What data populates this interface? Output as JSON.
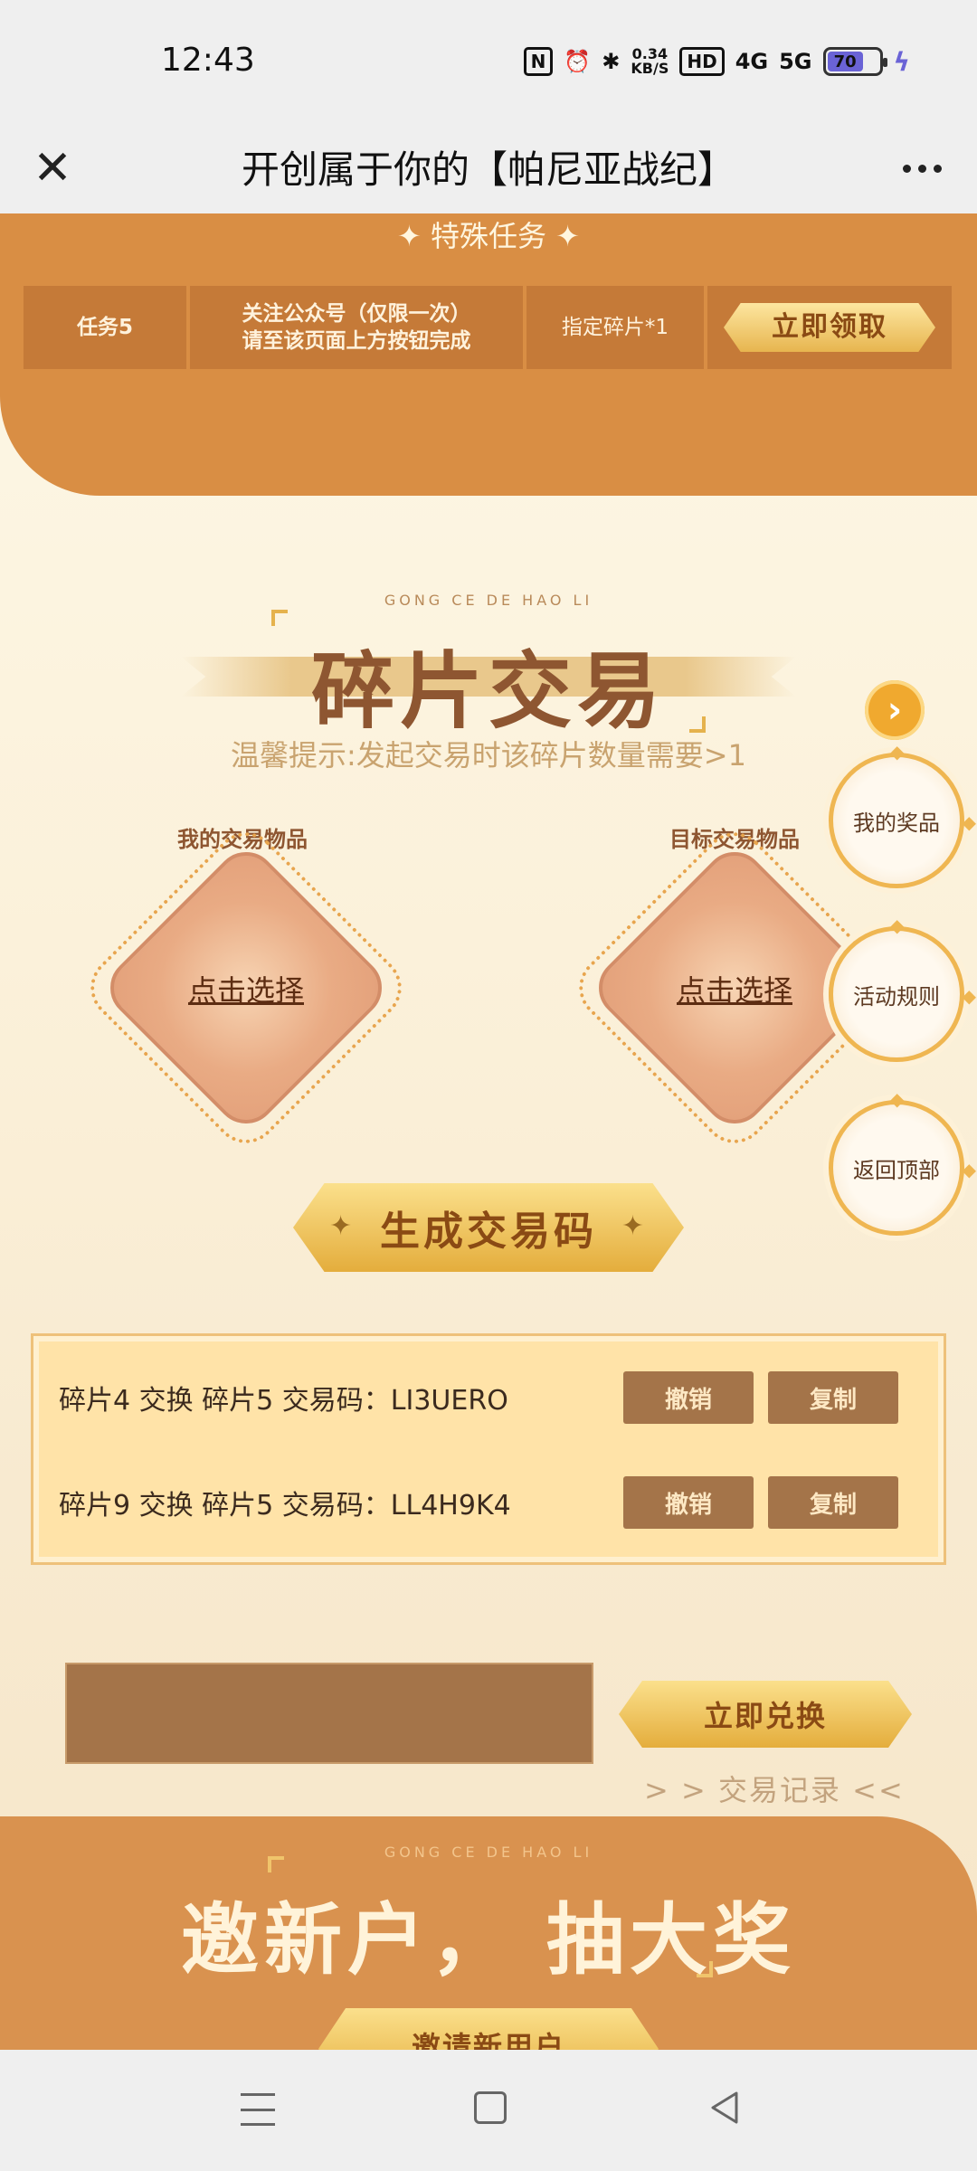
{
  "status_bar": {
    "time": "12:43",
    "nfc": "N",
    "alarm": "⏰",
    "bluetooth": "✱",
    "net_speed_value": "0.34",
    "net_speed_unit": "KB/S",
    "hd": "HD",
    "signal_1": "4G",
    "signal_2": "5G",
    "battery_level": "70",
    "charging_icon": "lightning-icon"
  },
  "title_bar": {
    "close_icon": "close-icon",
    "title": "开创属于你的【帕尼亚战纪】",
    "more_icon": "more-icon"
  },
  "special_task": {
    "heading": "✦ 特殊任务 ✦",
    "task_id": "任务5",
    "description_line1": "关注公众号（仅限一次）",
    "description_line2": "请至该页面上方按钮完成",
    "reward": "指定碎片*1",
    "claim_label": "立即领取"
  },
  "trade": {
    "subtitle": "GONG CE DE HAO LI",
    "title": "碎片交易",
    "hint": "温馨提示:发起交易时该碎片数量需要>1",
    "my_item_label": "我的交易物品",
    "target_item_label": "目标交易物品",
    "my_item_select": "点击选择",
    "target_item_select": "点击选择",
    "generate_label": "生成交易码",
    "codes": [
      {
        "text": "碎片4 交换 碎片5 交易码：LI3UERO",
        "cancel": "撤销",
        "copy": "复制"
      },
      {
        "text": "碎片9 交换 碎片5 交易码：LL4H9K4",
        "cancel": "撤销",
        "copy": "复制"
      }
    ],
    "redeem_label": "立即兑换",
    "log_label": "> > 交易记录 <<"
  },
  "side_buttons": {
    "arrow": "›",
    "prizes": "我的奖品",
    "rules": "活动规则",
    "top": "返回顶部"
  },
  "invite": {
    "subtitle": "GONG CE DE HAO LI",
    "title": "邀新户， 抽大奖",
    "button_label": "邀请新用户"
  },
  "colors": {
    "accent": "#d98e44",
    "button_brown": "#a47449",
    "gold": "#e4ad3c"
  }
}
